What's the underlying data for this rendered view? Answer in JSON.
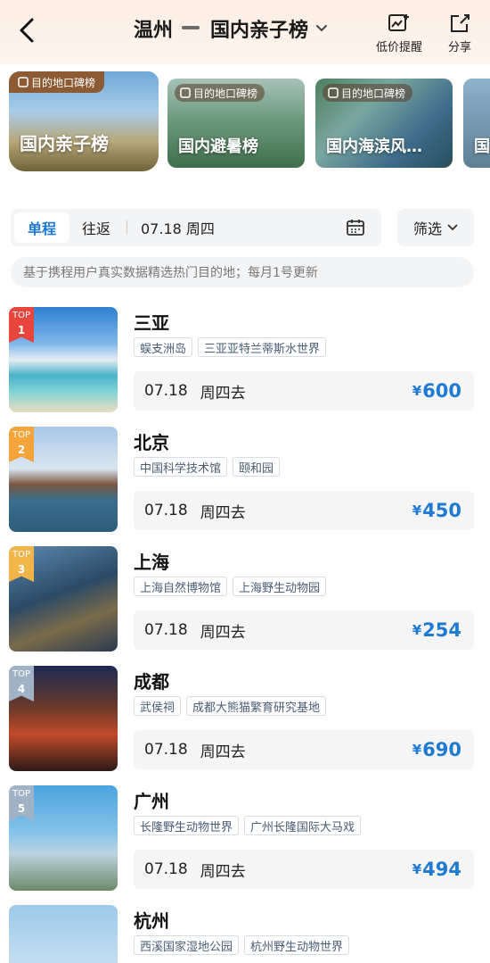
{
  "header": {
    "from_city": "温州",
    "title": "国内亲子榜",
    "price_alert_label": "低价提醒",
    "share_label": "分享"
  },
  "categories": [
    {
      "badge": "目的地口碑榜",
      "label": "国内亲子榜"
    },
    {
      "badge": "目的地口碑榜",
      "label": "国内避暑榜"
    },
    {
      "badge": "目的地口碑榜",
      "label": "国内海滨风…"
    },
    {
      "label": "国"
    }
  ],
  "search": {
    "one_way": "单程",
    "round_trip": "往返",
    "date": "07.18 周四",
    "filter": "筛选"
  },
  "notice": "基于携程用户真实数据精选热门目的地；每月1号更新",
  "items": [
    {
      "rank_label": "TOP",
      "rank": "1",
      "city": "三亚",
      "tags": [
        "蜈支洲岛",
        "三亚亚特兰蒂斯水世界"
      ],
      "date": "07.18",
      "weekday": "周四去",
      "currency": "¥",
      "price": "600"
    },
    {
      "rank_label": "TOP",
      "rank": "2",
      "city": "北京",
      "tags": [
        "中国科学技术馆",
        "颐和园"
      ],
      "date": "07.18",
      "weekday": "周四去",
      "currency": "¥",
      "price": "450"
    },
    {
      "rank_label": "TOP",
      "rank": "3",
      "city": "上海",
      "tags": [
        "上海自然博物馆",
        "上海野生动物园"
      ],
      "date": "07.18",
      "weekday": "周四去",
      "currency": "¥",
      "price": "254"
    },
    {
      "rank_label": "TOP",
      "rank": "4",
      "city": "成都",
      "tags": [
        "武侯祠",
        "成都大熊猫繁育研究基地"
      ],
      "date": "07.18",
      "weekday": "周四去",
      "currency": "¥",
      "price": "690"
    },
    {
      "rank_label": "TOP",
      "rank": "5",
      "city": "广州",
      "tags": [
        "长隆野生动物世界",
        "广州长隆国际大马戏"
      ],
      "date": "07.18",
      "weekday": "周四去",
      "currency": "¥",
      "price": "494"
    },
    {
      "city": "杭州",
      "tags": [
        "西溪国家湿地公园",
        "杭州野生动物世界"
      ]
    }
  ],
  "colors": {
    "accent": "#1f7ad1",
    "rank1": "#e8453c",
    "rank2": "#f5a43b",
    "rank3": "#f2b54a",
    "rank_other": "#9fb2c6"
  }
}
